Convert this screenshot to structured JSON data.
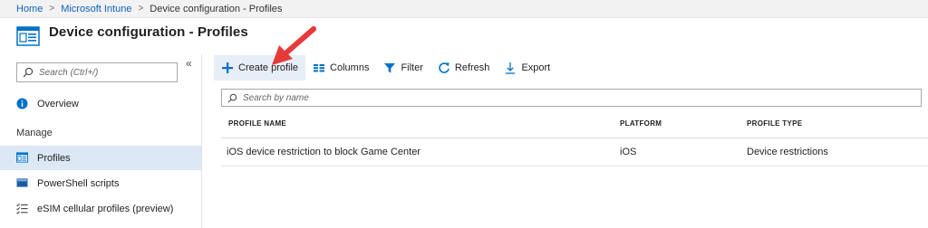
{
  "breadcrumb": {
    "items": [
      "Home",
      "Microsoft Intune",
      "Device configuration - Profiles"
    ]
  },
  "header": {
    "title": "Device configuration - Profiles"
  },
  "sidebar": {
    "search_placeholder": "Search (Ctrl+/)",
    "collapse_icon": "«",
    "overview_label": "Overview",
    "section_label": "Manage",
    "items": [
      {
        "label": "Profiles",
        "icon": "profiles-icon"
      },
      {
        "label": "PowerShell scripts",
        "icon": "powershell-icon"
      },
      {
        "label": "eSIM cellular profiles (preview)",
        "icon": "checklist-icon"
      }
    ]
  },
  "toolbar": {
    "create": "Create profile",
    "columns": "Columns",
    "filter": "Filter",
    "refresh": "Refresh",
    "export": "Export"
  },
  "filter_placeholder": "Search by name",
  "table": {
    "headers": [
      "PROFILE NAME",
      "PLATFORM",
      "PROFILE TYPE"
    ],
    "rows": [
      [
        "iOS device restriction to block Game Center",
        "iOS",
        "Device restrictions"
      ]
    ]
  },
  "colors": {
    "link": "#0f62b8",
    "accent": "#0072c6",
    "active_nav": "#dce8f6",
    "annotation": "#e8393a"
  }
}
